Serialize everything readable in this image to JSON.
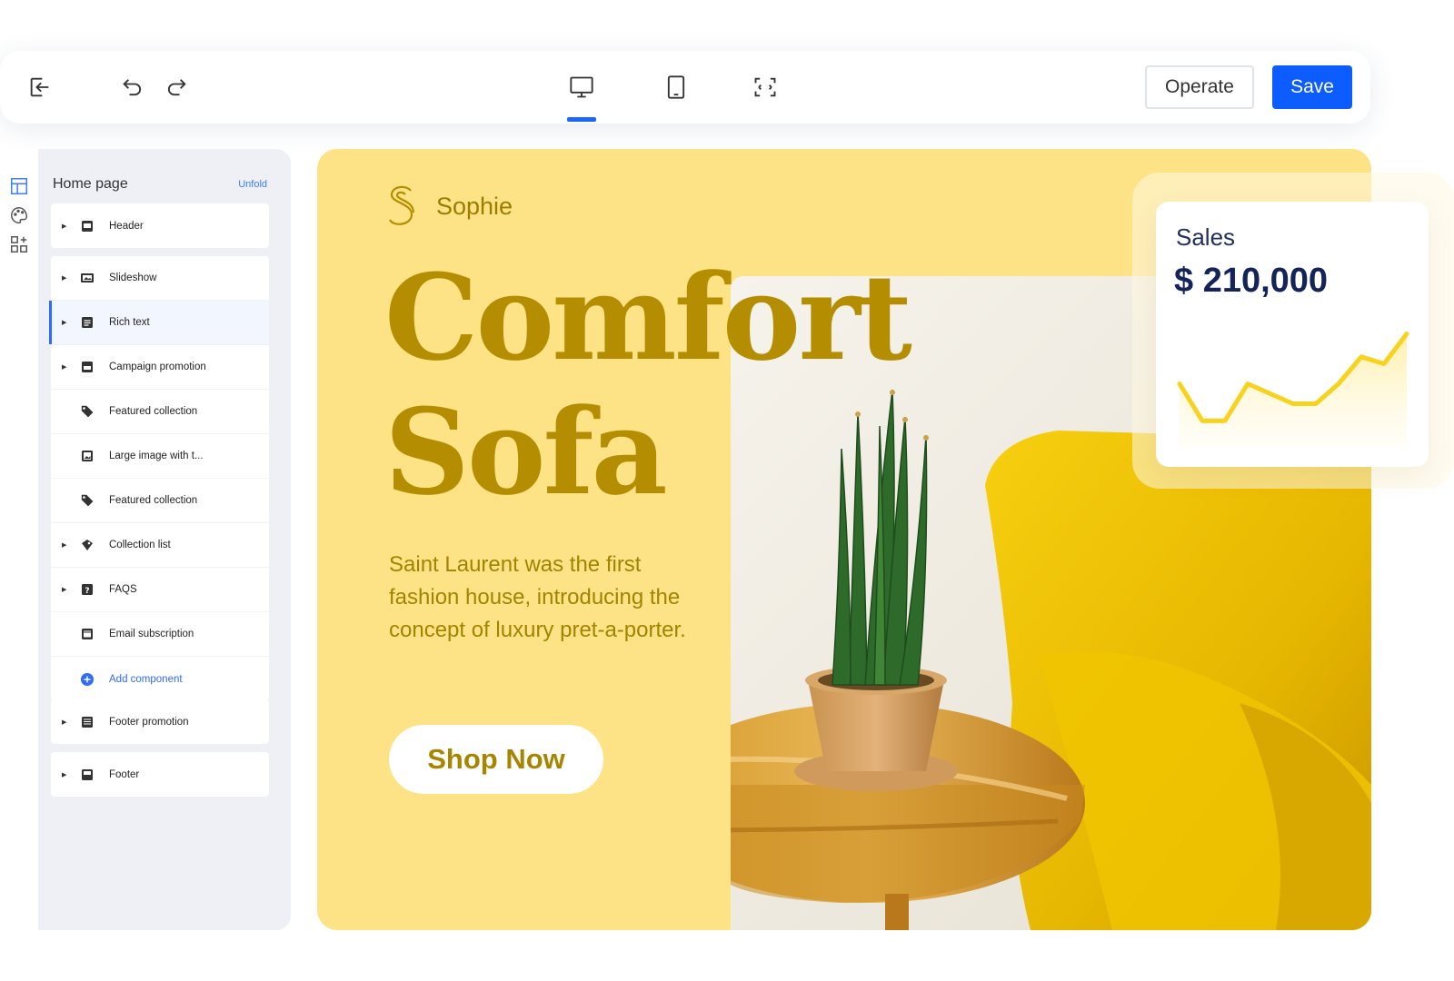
{
  "toolbar": {
    "operate_label": "Operate",
    "save_label": "Save",
    "icons": [
      "exit-icon",
      "undo-icon",
      "redo-icon",
      "desktop-icon",
      "tablet-icon",
      "fullscreen-icon"
    ],
    "active_device": "desktop"
  },
  "rail": {
    "icons": [
      "layout-icon",
      "palette-icon",
      "apps-icon"
    ]
  },
  "sidebar": {
    "title": "Home page",
    "unfold_label": "Unfold",
    "groups": [
      {
        "items": [
          {
            "label": "Header",
            "icon": "header-icon",
            "caret": true
          }
        ]
      },
      {
        "items": [
          {
            "label": "Slideshow",
            "icon": "slideshow-icon",
            "caret": true
          },
          {
            "label": "Rich text",
            "icon": "rich-text-icon",
            "caret": true,
            "active": true
          },
          {
            "label": "Campaign promotion",
            "icon": "campaign-icon",
            "caret": true
          },
          {
            "label": "Featured collection",
            "icon": "tag-icon",
            "caret": false
          },
          {
            "label": "Large image with t...",
            "icon": "image-icon",
            "caret": false
          },
          {
            "label": "Featured collection",
            "icon": "tag-icon",
            "caret": false
          },
          {
            "label": "Collection list",
            "icon": "collection-icon",
            "caret": true
          },
          {
            "label": "FAQS",
            "icon": "faq-icon",
            "caret": true
          },
          {
            "label": "Email subscription",
            "icon": "email-icon",
            "caret": false
          },
          {
            "label": "Add component",
            "icon": "add-icon",
            "caret": false,
            "link": true
          }
        ]
      },
      {
        "items": [
          {
            "label": "Footer promotion",
            "icon": "footer-promo-icon",
            "caret": true
          }
        ]
      },
      {
        "items": [
          {
            "label": "Footer",
            "icon": "footer-icon",
            "caret": true
          }
        ]
      }
    ]
  },
  "hero": {
    "brand_name": "Sophie",
    "title_line1": "Comfort",
    "title_line2": "Sofa",
    "description": "Saint Laurent was the first fashion house, introducing the concept of luxury pret-a-porter.",
    "cta_label": "Shop Now",
    "colors": {
      "background": "#fde385",
      "title": "#b48e00",
      "text": "#a28400"
    }
  },
  "sales": {
    "label": "Sales",
    "value": "$ 210,000",
    "trend": [
      0.45,
      0.08,
      0.08,
      0.45,
      0.35,
      0.25,
      0.25,
      0.45,
      0.72,
      0.65,
      0.95
    ]
  },
  "colors": {
    "accent": "#0c5cff"
  }
}
